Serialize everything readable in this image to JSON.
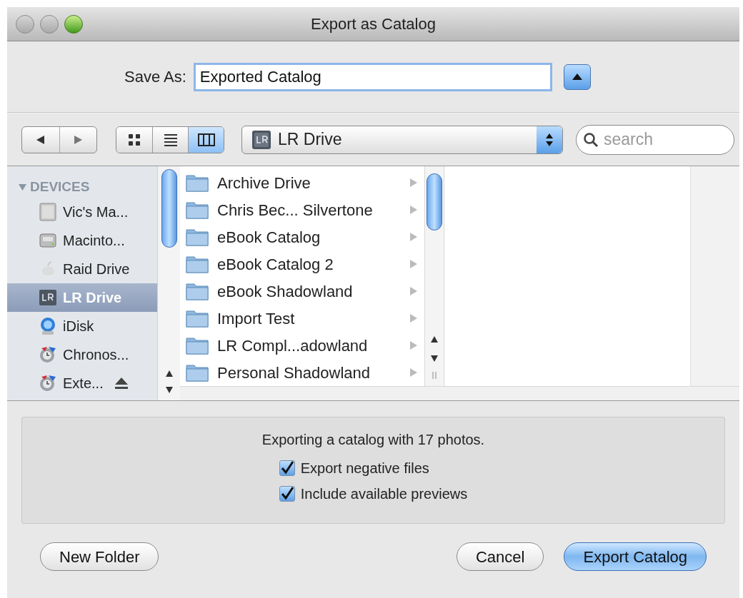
{
  "window": {
    "title": "Export as Catalog"
  },
  "save_as": {
    "label": "Save As:",
    "value": "Exported Catalog"
  },
  "toolbar": {
    "view_modes": [
      {
        "kind": "icons",
        "selected": false
      },
      {
        "kind": "list",
        "selected": false
      },
      {
        "kind": "columns",
        "selected": true
      }
    ],
    "location": "LR Drive",
    "search": {
      "placeholder": "search"
    }
  },
  "sidebar": {
    "header": "DEVICES",
    "items": [
      {
        "label": "Vic's Ma...",
        "kind": "computer",
        "selected": false
      },
      {
        "label": "Macinto...",
        "kind": "disk",
        "selected": false
      },
      {
        "label": "Raid Drive",
        "kind": "apple",
        "selected": false
      },
      {
        "label": "LR Drive",
        "kind": "lr",
        "selected": true
      },
      {
        "label": "iDisk",
        "kind": "idisk",
        "selected": false
      },
      {
        "label": "Chronos...",
        "kind": "backup",
        "selected": false
      },
      {
        "label": "Exte...",
        "kind": "backup",
        "selected": false,
        "ejectable": true
      }
    ]
  },
  "browser": {
    "column_1": [
      {
        "label": "Archive Drive"
      },
      {
        "label": "Chris Bec... Silvertone"
      },
      {
        "label": "eBook Catalog"
      },
      {
        "label": "eBook Catalog 2"
      },
      {
        "label": "eBook Shadowland"
      },
      {
        "label": "Import Test"
      },
      {
        "label": "LR Compl...adowland"
      },
      {
        "label": "Personal Shadowland"
      }
    ]
  },
  "options": {
    "message": "Exporting a catalog with 17 photos.",
    "checkboxes": [
      {
        "label": "Export negative files",
        "checked": true
      },
      {
        "label": "Include available previews",
        "checked": true
      }
    ]
  },
  "buttons": [
    {
      "label": "New Folder",
      "kind": "normal"
    },
    {
      "label": "Cancel",
      "kind": "normal"
    },
    {
      "label": "Export Catalog",
      "kind": "default"
    }
  ]
}
